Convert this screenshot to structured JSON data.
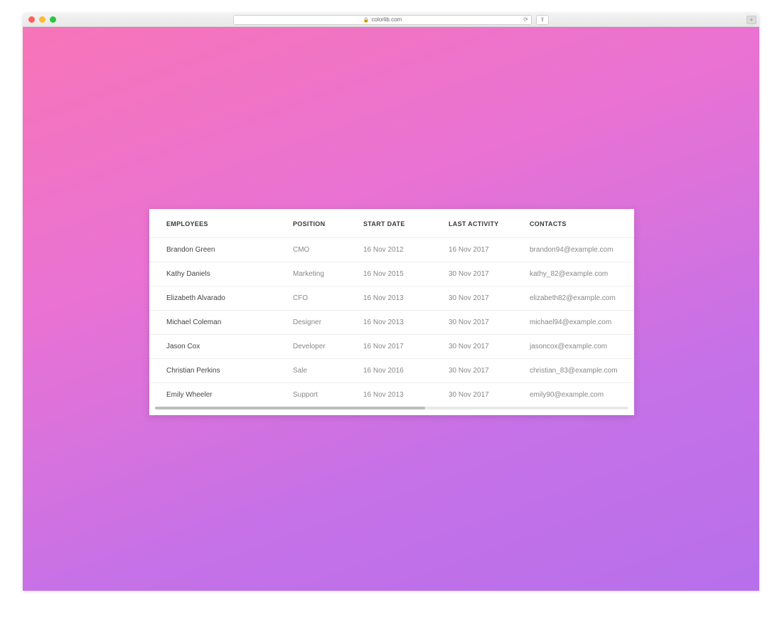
{
  "browser": {
    "url_host": "colorlib.com",
    "lock_icon": "lock-icon",
    "reload_icon": "reload-icon",
    "share_icon": "share-icon",
    "new_tab_icon": "plus-icon"
  },
  "table": {
    "headers": {
      "employees": "EMPLOYEES",
      "position": "POSITION",
      "start_date": "START DATE",
      "last_activity": "LAST ACTIVITY",
      "contacts": "CONTACTS"
    },
    "rows": [
      {
        "name": "Brandon Green",
        "position": "CMO",
        "start": "16 Nov 2012",
        "activity": "16 Nov 2017",
        "contact": "brandon94@example.com"
      },
      {
        "name": "Kathy Daniels",
        "position": "Marketing",
        "start": "16 Nov 2015",
        "activity": "30 Nov 2017",
        "contact": "kathy_82@example.com"
      },
      {
        "name": "Elizabeth Alvarado",
        "position": "CFO",
        "start": "16 Nov 2013",
        "activity": "30 Nov 2017",
        "contact": "elizabeth82@example.com"
      },
      {
        "name": "Michael Coleman",
        "position": "Designer",
        "start": "16 Nov 2013",
        "activity": "30 Nov 2017",
        "contact": "michael94@example.com"
      },
      {
        "name": "Jason Cox",
        "position": "Developer",
        "start": "16 Nov 2017",
        "activity": "30 Nov 2017",
        "contact": "jasoncox@example.com"
      },
      {
        "name": "Christian Perkins",
        "position": "Sale",
        "start": "16 Nov 2016",
        "activity": "30 Nov 2017",
        "contact": "christian_83@example.com"
      },
      {
        "name": "Emily Wheeler",
        "position": "Support",
        "start": "16 Nov 2013",
        "activity": "30 Nov 2017",
        "contact": "emily90@example.com"
      }
    ]
  }
}
